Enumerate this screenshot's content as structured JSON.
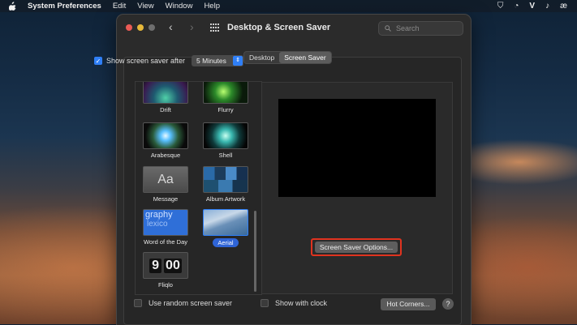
{
  "menubar": {
    "app_name": "System Preferences",
    "items": [
      "Edit",
      "View",
      "Window",
      "Help"
    ],
    "status_icons": [
      "vpn-shield-icon",
      "chat-bubble-icon",
      "v-logo-icon",
      "bell-icon",
      "ae-icon"
    ],
    "status_glyphs": [
      "⛉",
      "◔",
      "V",
      "♪",
      "æ"
    ]
  },
  "window": {
    "title": "Desktop & Screen Saver",
    "search_placeholder": "Search",
    "tabs": [
      {
        "label": "Desktop",
        "active": false
      },
      {
        "label": "Screen Saver",
        "active": true
      }
    ]
  },
  "settings": {
    "show_after_label": "Show screen saver after",
    "show_after_checked": true,
    "show_after_value": "5 Minutes"
  },
  "savers": [
    {
      "name": "Drift",
      "selected": false
    },
    {
      "name": "Flurry",
      "selected": false
    },
    {
      "name": "Arabesque",
      "selected": false
    },
    {
      "name": "Shell",
      "selected": false
    },
    {
      "name": "Message",
      "selected": false
    },
    {
      "name": "Album Artwork",
      "selected": false
    },
    {
      "name": "Word of the Day",
      "selected": false
    },
    {
      "name": "Aerial",
      "selected": true
    },
    {
      "name": "Fliqlo",
      "selected": false
    }
  ],
  "thumb_text": {
    "message": "Aa",
    "word_of_day_1": "graphy",
    "word_of_day_2": "lexico",
    "fliqlo_hour": "9",
    "fliqlo_min": "00"
  },
  "buttons": {
    "options": "Screen Saver Options...",
    "hot_corners": "Hot Corners...",
    "help": "?"
  },
  "bottom": {
    "random_label": "Use random screen saver",
    "random_checked": false,
    "clock_label": "Show with clock",
    "clock_checked": false
  },
  "colors": {
    "accent": "#2f7ff6",
    "highlight_border": "#e0331f"
  }
}
